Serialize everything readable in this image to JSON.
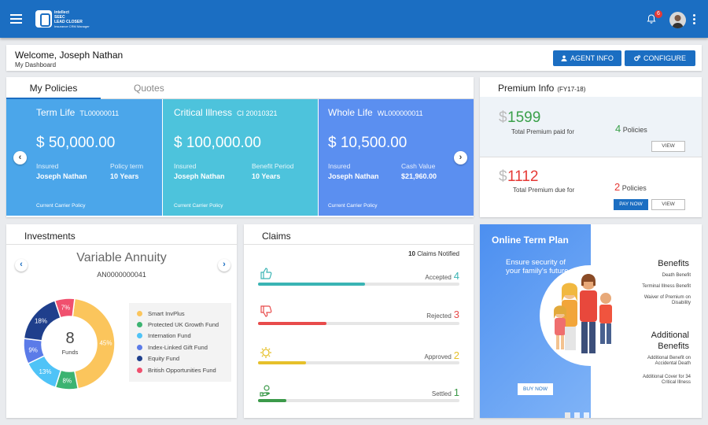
{
  "header": {
    "logo_line1": "intellect",
    "logo_line2": "SEEC",
    "logo_line3": "LEAD CLOSER",
    "logo_line4": "Insurance CRM Manager",
    "notification_count": "6"
  },
  "welcome": {
    "title": "Welcome, Joseph Nathan",
    "subtitle": "My Dashboard",
    "agent_info_label": "AGENT INFO",
    "configure_label": "CONFIGURE"
  },
  "policies": {
    "tab_policies": "My Policies",
    "tab_quotes": "Quotes",
    "cards": [
      {
        "name": "Term Life",
        "number": "TL00000011",
        "amount": "$ 50,000.00",
        "label1": "Insured",
        "value1": "Joseph Nathan",
        "label2": "Policy term",
        "value2": "10 Years",
        "footer": "Current Carrier Policy",
        "color": "#4ba6ea"
      },
      {
        "name": "Critical Illness",
        "number": "CI 20010321",
        "amount": "$ 100,000.00",
        "label1": "Insured",
        "value1": "Joseph Nathan",
        "label2": "Benefit Period",
        "value2": "10 Years",
        "footer": "Current Carrier Policy",
        "color": "#4dc3dc"
      },
      {
        "name": "Whole Life",
        "number": "WL000000011",
        "amount": "$ 10,500.00",
        "label1": "Insured",
        "value1": "Joseph Nathan",
        "label2": "Cash Value",
        "value2": "$21,960.00",
        "footer": "Current Carrier Policy",
        "color": "#5b8ff0"
      }
    ]
  },
  "premium": {
    "title": "Premium Info",
    "period": "(FY17-18)",
    "paid_dollar": "$",
    "paid_amount": "1599",
    "paid_label": "Total Premium paid for",
    "paid_count": "4",
    "paid_count_label": "Policies",
    "view_label": "VIEW",
    "due_dollar": "$",
    "due_amount": "1112",
    "due_label": "Total Premium due for",
    "due_count": "2",
    "due_count_label": "Policies",
    "pay_now_label": "PAY NOW",
    "view2_label": "VIEW"
  },
  "investments": {
    "title": "Investments",
    "product": "Variable Annuity",
    "code": "AN0000000041",
    "center_number": "8",
    "center_label": "Funds",
    "legend": [
      {
        "name": "Smart InvPlus",
        "color": "#fbc55c"
      },
      {
        "name": "Protected UK Growth Fund",
        "color": "#3cb371"
      },
      {
        "name": "Internation Fund",
        "color": "#4fc3f7"
      },
      {
        "name": "Index-Linked  Gift Fund",
        "color": "#5b7be8"
      },
      {
        "name": "Equity Fund",
        "color": "#1f3f8c"
      },
      {
        "name": "British Opportunities Fund",
        "color": "#f0506e"
      }
    ],
    "chart_data": {
      "type": "pie",
      "categories": [
        "Smart InvPlus",
        "Protected UK Growth Fund",
        "Internation Fund",
        "Index-Linked  Gift Fund",
        "Equity Fund",
        "British Opportunities Fund"
      ],
      "values": [
        45,
        8,
        13,
        9,
        18,
        7
      ],
      "labels": [
        "45%",
        "8%",
        "13%",
        "9%",
        "18%",
        "7%"
      ]
    }
  },
  "claims": {
    "title": "Claims",
    "notified_count": "10",
    "notified_label": "Claims Notified",
    "items": [
      {
        "label": "Accepted",
        "count": "4",
        "fraction": 0.53,
        "color": "#3ab4b4"
      },
      {
        "label": "Rejected",
        "count": "3",
        "fraction": 0.34,
        "color": "#e84b4b"
      },
      {
        "label": "Approved",
        "count": "2",
        "fraction": 0.24,
        "color": "#e6c02a"
      },
      {
        "label": "Settled",
        "count": "1",
        "fraction": 0.14,
        "color": "#3c9a4a"
      }
    ]
  },
  "online": {
    "title": "Online Term Plan",
    "subtitle": "Ensure security of your family's future.",
    "buy_now_label": "BUY NOW",
    "benefits_title": "Benefits",
    "benefit1": "Death Benefit",
    "benefit2": "Terminal Illness Benefit",
    "benefit3": "Waiver of Premium on Disability",
    "additional_title_1": "Additional",
    "additional_title_2": "Benefits",
    "additional1": "Additional Benefit on Accidental Death",
    "additional2": "Additional Cover for 34 Critical Illness"
  }
}
